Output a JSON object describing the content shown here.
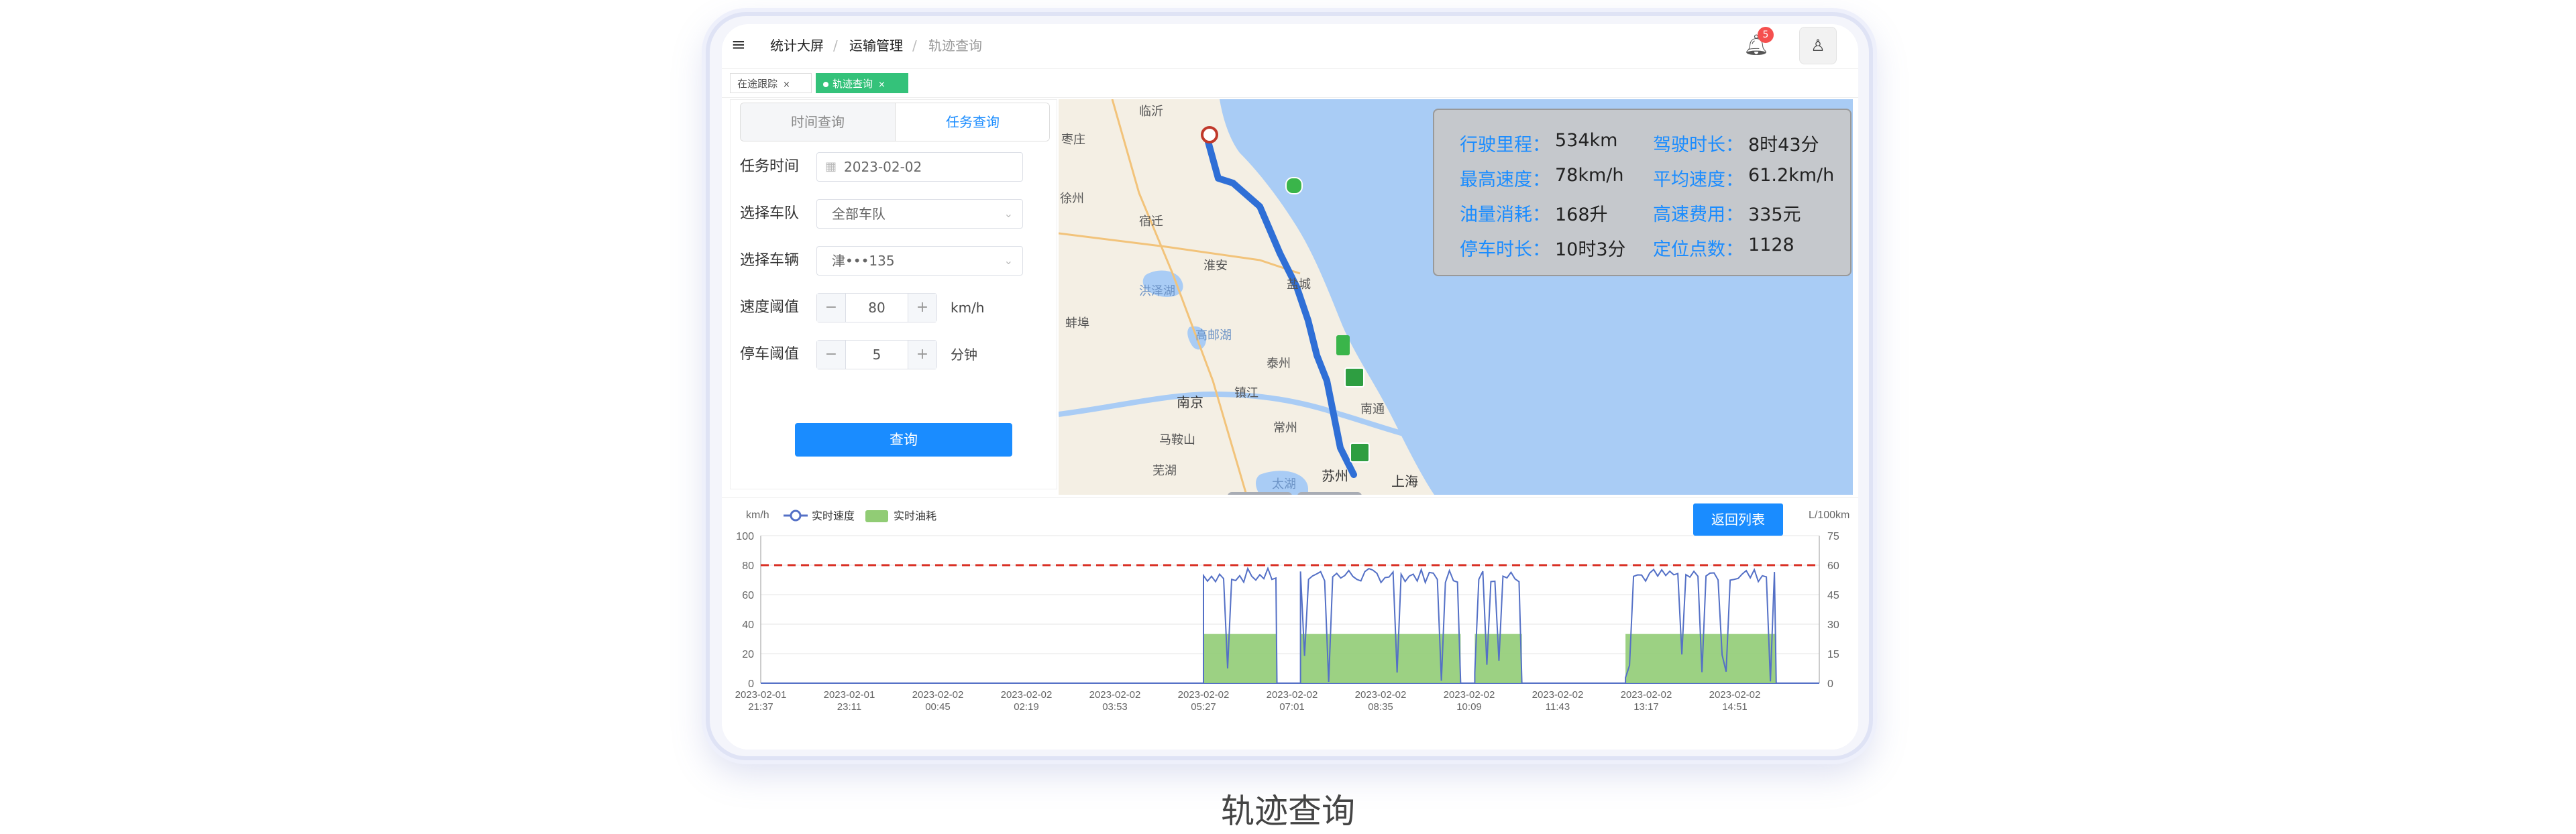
{
  "header": {
    "breadcrumb": [
      "统计大屏",
      "运输管理",
      "轨迹查询"
    ],
    "separator": "/",
    "notification_count": "5"
  },
  "tags": [
    {
      "label": "在途跟踪",
      "active": false
    },
    {
      "label": "轨迹查询",
      "active": true
    }
  ],
  "tag_close": "×",
  "query_panel": {
    "tabs": [
      "时间查询",
      "任务查询"
    ],
    "active_tab": "任务查询",
    "fields": {
      "task_time_label": "任务时间",
      "task_time_value": "2023-02-02",
      "fleet_label": "选择车队",
      "fleet_value": "全部车队",
      "vehicle_label": "选择车辆",
      "vehicle_value": "津•••135",
      "speed_label": "速度阈值",
      "speed_value": "80",
      "speed_unit": "km/h",
      "stop_label": "停车阈值",
      "stop_value": "5",
      "stop_unit": "分钟"
    },
    "query_button": "查询"
  },
  "map": {
    "places": [
      "临沂",
      "枣庄",
      "徐州",
      "宿迁",
      "淮安",
      "盐城",
      "洪泽湖",
      "蚌埠",
      "高邮湖",
      "泰州",
      "南京",
      "镇江",
      "常州",
      "南通",
      "马鞍山",
      "芜湖",
      "太湖",
      "苏州",
      "上海"
    ],
    "route_color": "#2f6fd6",
    "sea_color": "#a9ccf5"
  },
  "stats": [
    {
      "label": "行驶里程：",
      "value": "534km"
    },
    {
      "label": "驾驶时长：",
      "value": "8时43分"
    },
    {
      "label": "最高速度：",
      "value": "78km/h"
    },
    {
      "label": "平均速度：",
      "value": "61.2km/h"
    },
    {
      "label": "油量消耗：",
      "value": "168升"
    },
    {
      "label": "高速费用：",
      "value": "335元"
    },
    {
      "label": "停车时长：",
      "value": "10时3分"
    },
    {
      "label": "定位点数：",
      "value": "1128"
    }
  ],
  "back_button": "返回列表",
  "chart_data": {
    "type": "line",
    "x": [
      "2023-02-01 21:37",
      "2023-02-01 23:11",
      "2023-02-02 00:45",
      "2023-02-02 02:19",
      "2023-02-02 03:53",
      "2023-02-02 05:27",
      "2023-02-02 07:01",
      "2023-02-02 08:35",
      "2023-02-02 10:09",
      "2023-02-02 11:43",
      "2023-02-02 13:17",
      "2023-02-02 14:51"
    ],
    "ylabel_left": "km/h",
    "ylabel_right": "L/100km",
    "ylim_left": [
      0,
      100
    ],
    "ylim_right": [
      0,
      75
    ],
    "yticks_left": [
      "100",
      "80",
      "60",
      "40",
      "20",
      "0"
    ],
    "yticks_right": [
      "75",
      "60",
      "45",
      "30",
      "15",
      "0"
    ],
    "threshold": 80,
    "legend_position": "top-left",
    "series": [
      {
        "name": "实时速度",
        "type": "line",
        "color": "#5470c6",
        "segments": [
          {
            "start": "2023-02-02 05:27",
            "end": "2023-02-02 06:45",
            "level": 72
          },
          {
            "start": "2023-02-02 07:10",
            "end": "2023-02-02 10:00",
            "level": 72
          },
          {
            "start": "2023-02-02 10:15",
            "end": "2023-02-02 11:05",
            "level": 72
          },
          {
            "start": "2023-02-02 12:55",
            "end": "2023-02-02 15:35",
            "level": 72
          }
        ],
        "max": 78
      },
      {
        "name": "实时油耗",
        "type": "area",
        "color": "#91cc75",
        "segments": [
          {
            "start": "2023-02-02 05:27",
            "end": "2023-02-02 06:45",
            "level": 25
          },
          {
            "start": "2023-02-02 07:10",
            "end": "2023-02-02 10:00",
            "level": 25
          },
          {
            "start": "2023-02-02 10:15",
            "end": "2023-02-02 11:05",
            "level": 25
          },
          {
            "start": "2023-02-02 12:55",
            "end": "2023-02-02 15:35",
            "level": 25
          }
        ]
      }
    ]
  },
  "caption": "轨迹查询"
}
